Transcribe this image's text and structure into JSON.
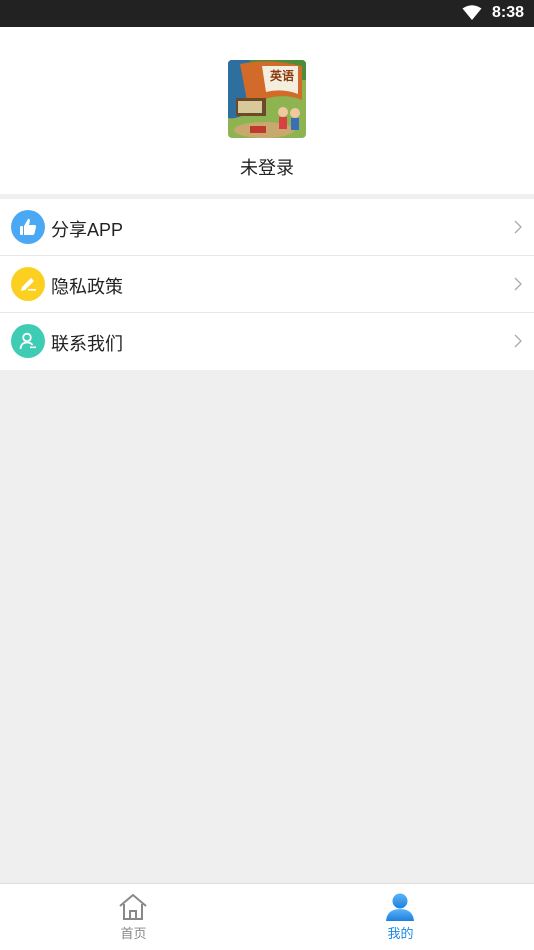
{
  "status_bar": {
    "time": "8:38",
    "icons": [
      "wifi-icon"
    ]
  },
  "profile": {
    "avatar_icon": "textbook-cover-icon",
    "avatar_title": "英语",
    "username": "未登录"
  },
  "menu": {
    "items": [
      {
        "label": "分享APP",
        "icon": "thumbs-up-icon",
        "color": "#4aa8f5"
      },
      {
        "label": "隐私政策",
        "icon": "pencil-icon",
        "color": "#fbd020"
      },
      {
        "label": "联系我们",
        "icon": "contact-person-icon",
        "color": "#3ecdb4"
      }
    ]
  },
  "tabbar": {
    "tabs": [
      {
        "label": "首页",
        "icon": "home-icon",
        "active": false,
        "color": "#888888"
      },
      {
        "label": "我的",
        "icon": "user-icon",
        "active": true,
        "color": "#1e88e5"
      }
    ]
  }
}
